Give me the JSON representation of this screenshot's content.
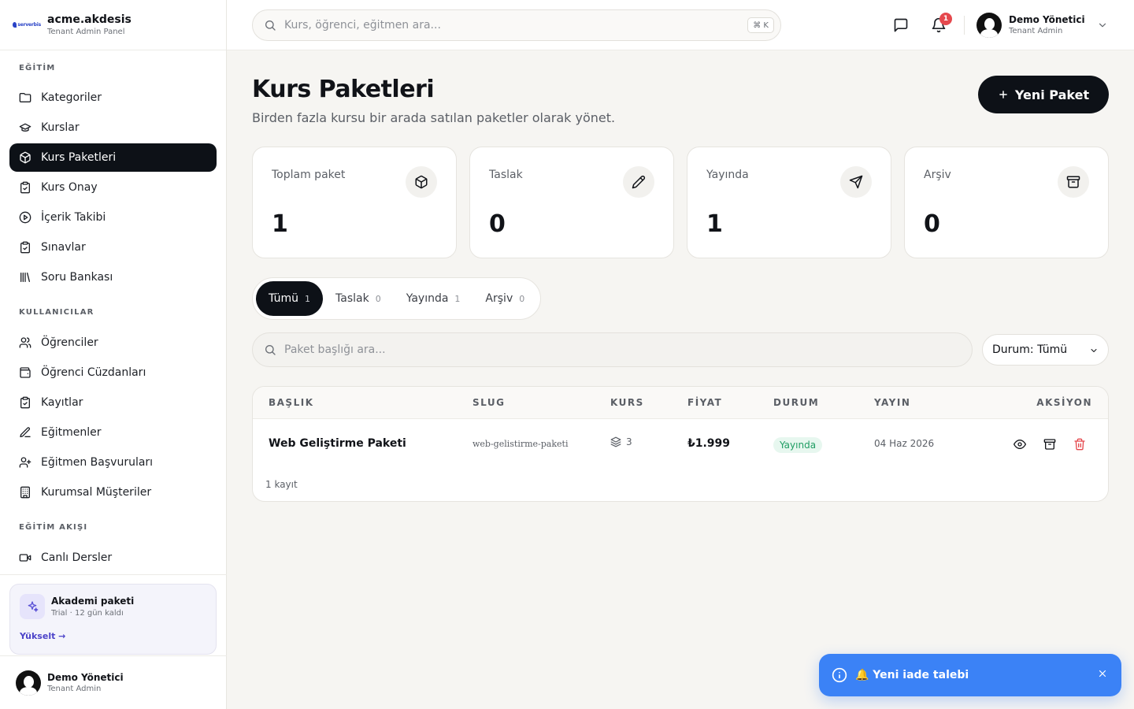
{
  "brand": {
    "logo_word": "serverbis",
    "name": "acme.akdesis",
    "subtitle": "Tenant Admin Panel"
  },
  "sidebar": {
    "sections": [
      {
        "title": "EĞİTİM",
        "items": [
          {
            "label": "Kategoriler",
            "icon": "folder-icon"
          },
          {
            "label": "Kurslar",
            "icon": "graduation-cap-icon"
          },
          {
            "label": "Kurs Paketleri",
            "icon": "package-icon",
            "active": true
          },
          {
            "label": "Kurs Onay",
            "icon": "clipboard-check-icon"
          },
          {
            "label": "İçerik Takibi",
            "icon": "play-circle-icon"
          },
          {
            "label": "Sınavlar",
            "icon": "clipboard-check-icon"
          },
          {
            "label": "Soru Bankası",
            "icon": "library-icon"
          }
        ]
      },
      {
        "title": "KULLANICILAR",
        "items": [
          {
            "label": "Öğrenciler",
            "icon": "users-icon"
          },
          {
            "label": "Öğrenci Cüzdanları",
            "icon": "wallet-icon"
          },
          {
            "label": "Kayıtlar",
            "icon": "clipboard-check-icon"
          },
          {
            "label": "Eğitmenler",
            "icon": "pen-icon"
          },
          {
            "label": "Eğitmen Başvuruları",
            "icon": "user-plus-icon"
          },
          {
            "label": "Kurumsal Müşteriler",
            "icon": "building-icon"
          }
        ]
      },
      {
        "title": "EĞİTİM AKIŞI",
        "items": [
          {
            "label": "Canlı Dersler",
            "icon": "video-icon"
          }
        ]
      }
    ],
    "plan": {
      "title": "Akademi paketi",
      "subtitle": "Trial · 12 gün kaldı",
      "link": "Yükselt →"
    },
    "user": {
      "name": "Demo Yönetici",
      "role": "Tenant Admin"
    }
  },
  "header": {
    "search_placeholder": "Kurs, öğrenci, eğitmen ara...",
    "shortcut": "⌘ K",
    "notification_count": "1",
    "user": {
      "name": "Demo Yönetici",
      "role": "Tenant Admin"
    }
  },
  "page": {
    "title": "Kurs Paketleri",
    "subtitle": "Birden fazla kursu bir arada satılan paketler olarak yönet.",
    "new_button": "Yeni Paket"
  },
  "stats": [
    {
      "label": "Toplam paket",
      "value": "1",
      "icon": "package-icon"
    },
    {
      "label": "Taslak",
      "value": "0",
      "icon": "pencil-icon"
    },
    {
      "label": "Yayında",
      "value": "1",
      "icon": "send-icon"
    },
    {
      "label": "Arşiv",
      "value": "0",
      "icon": "archive-icon"
    }
  ],
  "tabs": [
    {
      "label": "Tümü",
      "count": "1",
      "active": true
    },
    {
      "label": "Taslak",
      "count": "0"
    },
    {
      "label": "Yayında",
      "count": "1"
    },
    {
      "label": "Arşiv",
      "count": "0"
    }
  ],
  "filters": {
    "search_placeholder": "Paket başlığı ara...",
    "status_value": "Durum: Tümü"
  },
  "table": {
    "columns": [
      "BAŞLIK",
      "SLUG",
      "KURS",
      "FİYAT",
      "DURUM",
      "YAYIN",
      "AKSİYON"
    ],
    "rows": [
      {
        "title": "Web Geliştirme Paketi",
        "slug": "web-gelistirme-paketi",
        "courses": "3",
        "price": "₺1.999",
        "status": "Yayında",
        "published": "04 Haz 2026"
      }
    ],
    "footer": "1 kayıt"
  },
  "colors": {
    "accent_dark": "#0d1117",
    "success": "#1f9d63",
    "danger": "#e5484d",
    "toast": "#3b82f6"
  },
  "toast": {
    "message": "🔔 Yeni iade talebi"
  }
}
